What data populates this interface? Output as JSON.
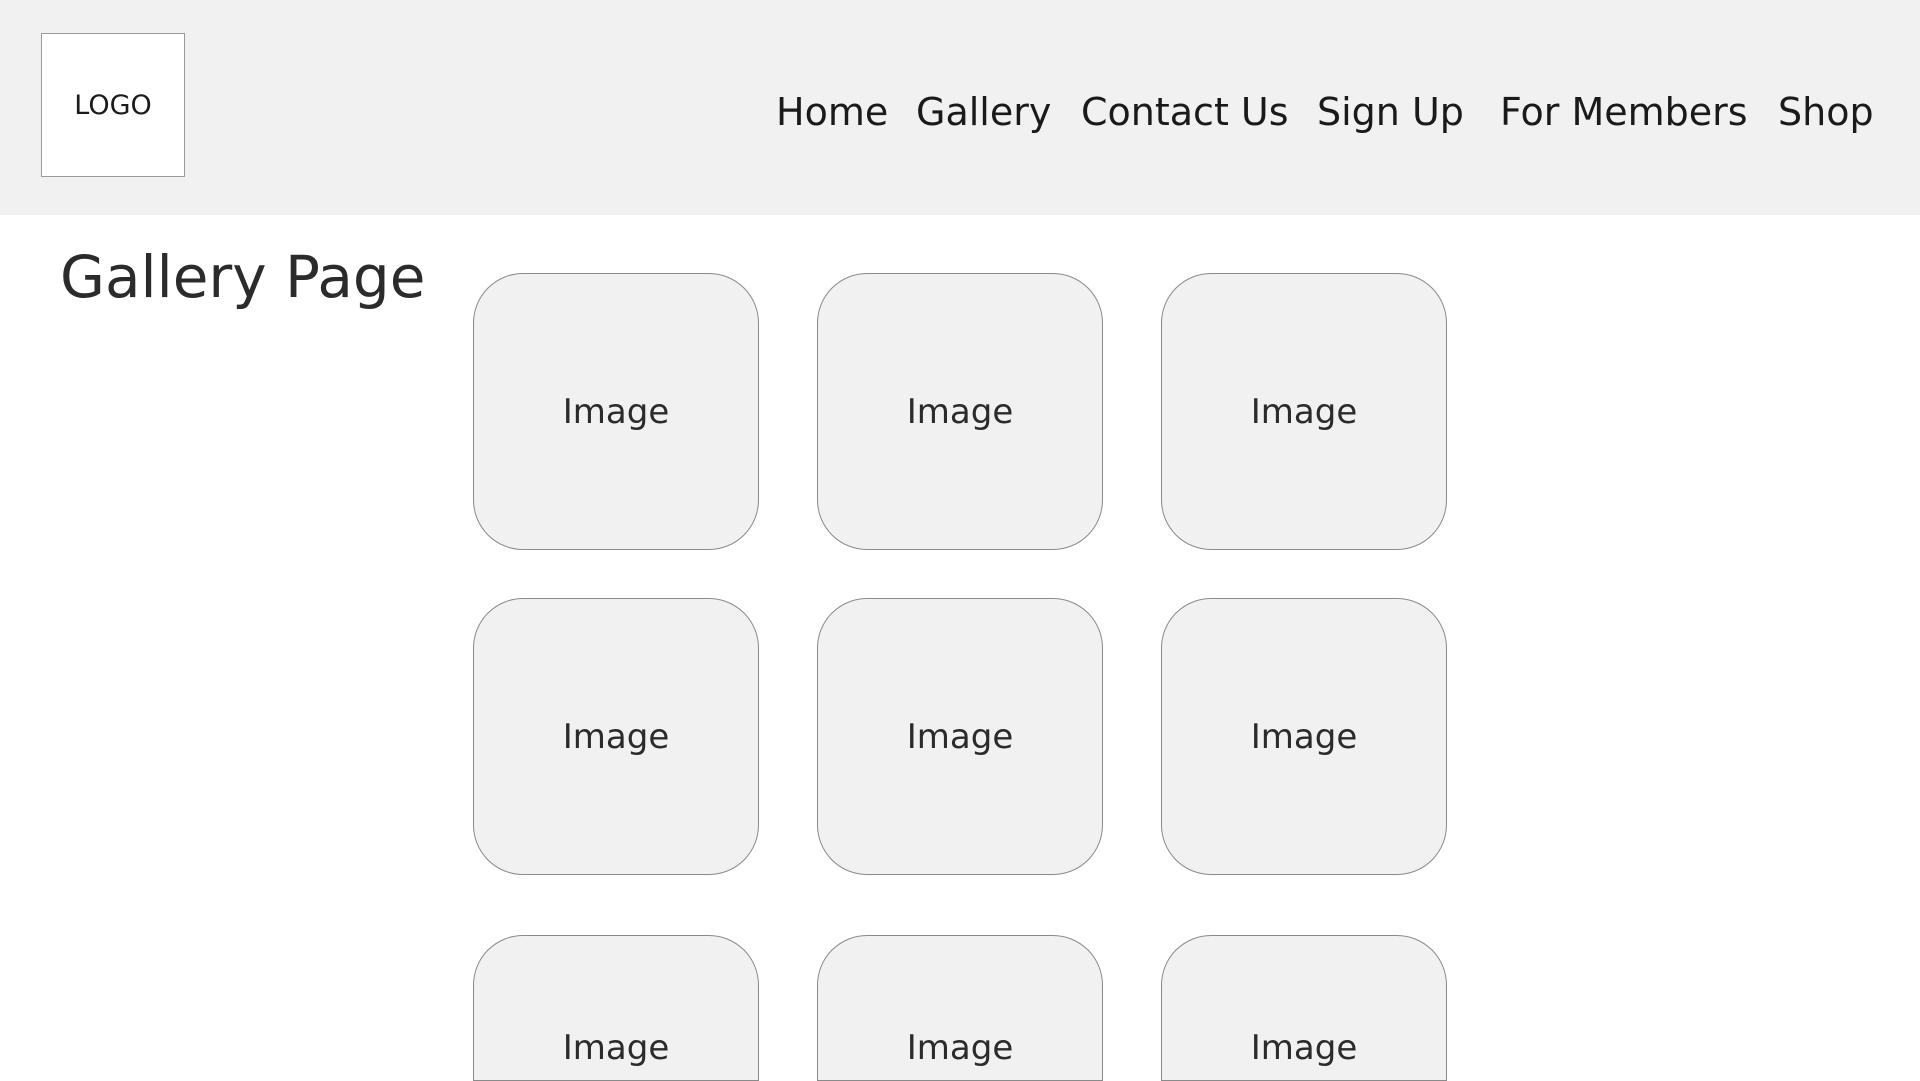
{
  "header": {
    "logo_text": "LOGO",
    "nav": [
      {
        "label": "Home"
      },
      {
        "label": "Gallery"
      },
      {
        "label": "Contact Us"
      },
      {
        "label": "Sign Up"
      },
      {
        "label": "For Members"
      },
      {
        "label": "Shop"
      }
    ]
  },
  "main": {
    "title": "Gallery Page",
    "images": [
      {
        "label": "Image"
      },
      {
        "label": "Image"
      },
      {
        "label": "Image"
      },
      {
        "label": "Image"
      },
      {
        "label": "Image"
      },
      {
        "label": "Image"
      },
      {
        "label": "Image"
      },
      {
        "label": "Image"
      },
      {
        "label": "Image"
      }
    ]
  },
  "colors": {
    "header_bg": "#f1f1f1",
    "tile_bg": "#f1f1f1",
    "tile_border": "#8a8a8a",
    "text": "#1a1a1a"
  }
}
